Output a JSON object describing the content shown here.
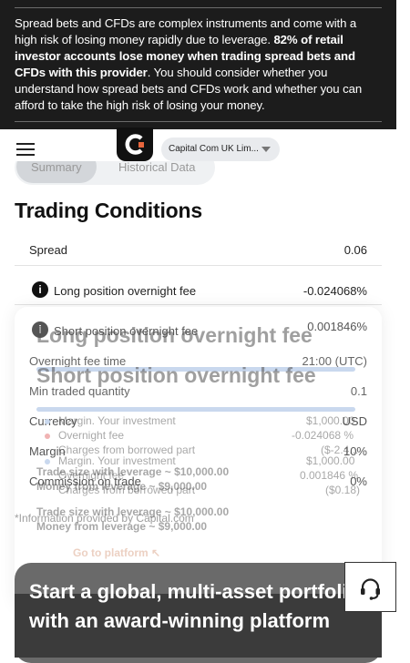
{
  "risk_warning": {
    "part1": "Spread bets and CFDs are complex instruments and come with a high risk of losing money rapidly due to leverage. ",
    "bold": "82% of retail investor accounts lose money when trading spread bets and CFDs with this provider",
    "part2": ". You should consider whether you understand how spread bets and CFDs work and whether you can afford to take the high risk of losing your money."
  },
  "header": {
    "logo_letter": "c",
    "entity_select": "Capital Com UK Lim..."
  },
  "tabs": [
    {
      "label": "Summary",
      "active": true
    },
    {
      "label": "Historical Data",
      "active": false
    }
  ],
  "page_title": "Trading Conditions",
  "rows": {
    "spread": {
      "label": "Spread",
      "value": "0.06"
    },
    "long_fee": {
      "label": "Long position overnight fee",
      "value": "-0.024068%"
    },
    "short_fee": {
      "label": "Short position overnight fee",
      "value": "0.001846%"
    },
    "fee_time": {
      "label": "Overnight fee time",
      "value": "21:00 (UTC)"
    },
    "min_qty": {
      "label": "Min traded quantity",
      "value": "0.1"
    },
    "currency": {
      "label": "Currency",
      "value": "USD"
    },
    "margin": {
      "label": "Margin",
      "value": "10%"
    },
    "commission": {
      "label": "Commission on trade",
      "value": "0%"
    }
  },
  "footnote": "*Information provided by Capital.com",
  "ghost": {
    "long_title": "Long position overnight fee",
    "short_title": "Short position overnight fee",
    "margin_investment": "Margin. Your investment",
    "overnight_fee": "Overnight fee",
    "charges": "Charges from borrowed part",
    "long_investment_value": "$1,000.00",
    "long_fee_value": "-0.024068 %",
    "long_charges_value": "($-2.4...",
    "short_investment_value": "$1,000.00",
    "short_fee_value": "0.001846 %",
    "short_charges_value": "($0.18)",
    "trade_size": "Trade size with leverage ~ $10,000.00",
    "leverage_money": "Money from leverage ~ $9,000.00",
    "go_to_platform": "Go to platform"
  },
  "promo": {
    "headline": "Start a global, multi-asset portfolio with an award-winning platform"
  },
  "colors": {
    "banner_bg": "#1c1c1c",
    "promo_bg": "#6a6a6a"
  },
  "icons": {
    "menu": "hamburger-icon",
    "info": "info-icon",
    "support": "headset-icon"
  }
}
